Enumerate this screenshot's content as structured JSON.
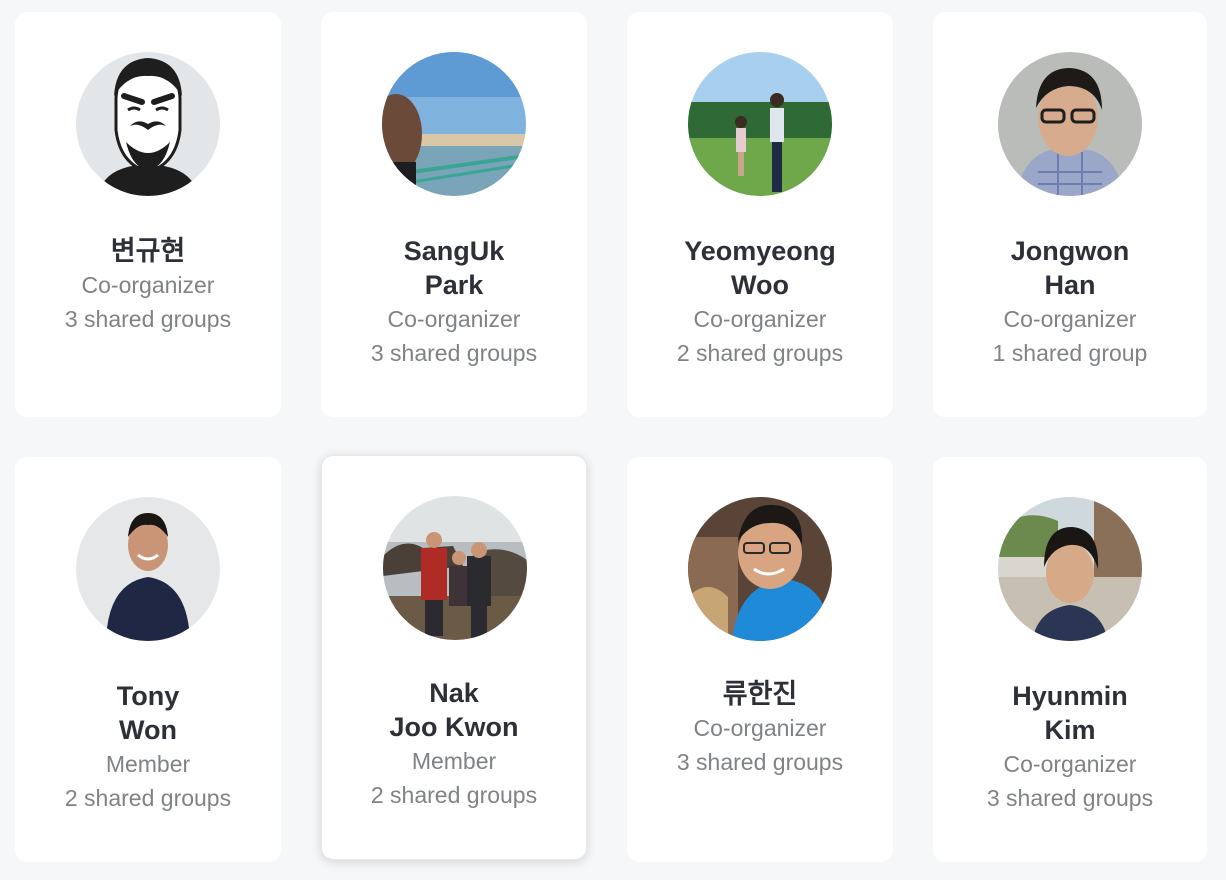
{
  "members": [
    {
      "first": "변규현",
      "last": "",
      "role": "Co-organizer",
      "groups": "3 shared groups",
      "avatar": "cartoon-avatar"
    },
    {
      "first": "SangUk",
      "last": "Park",
      "role": "Co-organizer",
      "groups": "3 shared groups",
      "avatar": "beach-photo"
    },
    {
      "first": "Yeomyeong",
      "last": "Woo",
      "role": "Co-organizer",
      "groups": "2 shared groups",
      "avatar": "field-photo"
    },
    {
      "first": "Jongwon",
      "last": "Han",
      "role": "Co-organizer",
      "groups": "1 shared group",
      "avatar": "portrait-photo"
    },
    {
      "first": "Tony",
      "last": "Won",
      "role": "Member",
      "groups": "2 shared groups",
      "avatar": "studio-photo"
    },
    {
      "first": "Nak",
      "last": "Joo Kwon",
      "role": "Member",
      "groups": "2 shared groups",
      "avatar": "family-photo"
    },
    {
      "first": "류한진",
      "last": "",
      "role": "Co-organizer",
      "groups": "3 shared groups",
      "avatar": "restaurant-photo"
    },
    {
      "first": "Hyunmin",
      "last": "Kim",
      "role": "Co-organizer",
      "groups": "3 shared groups",
      "avatar": "street-photo"
    }
  ]
}
